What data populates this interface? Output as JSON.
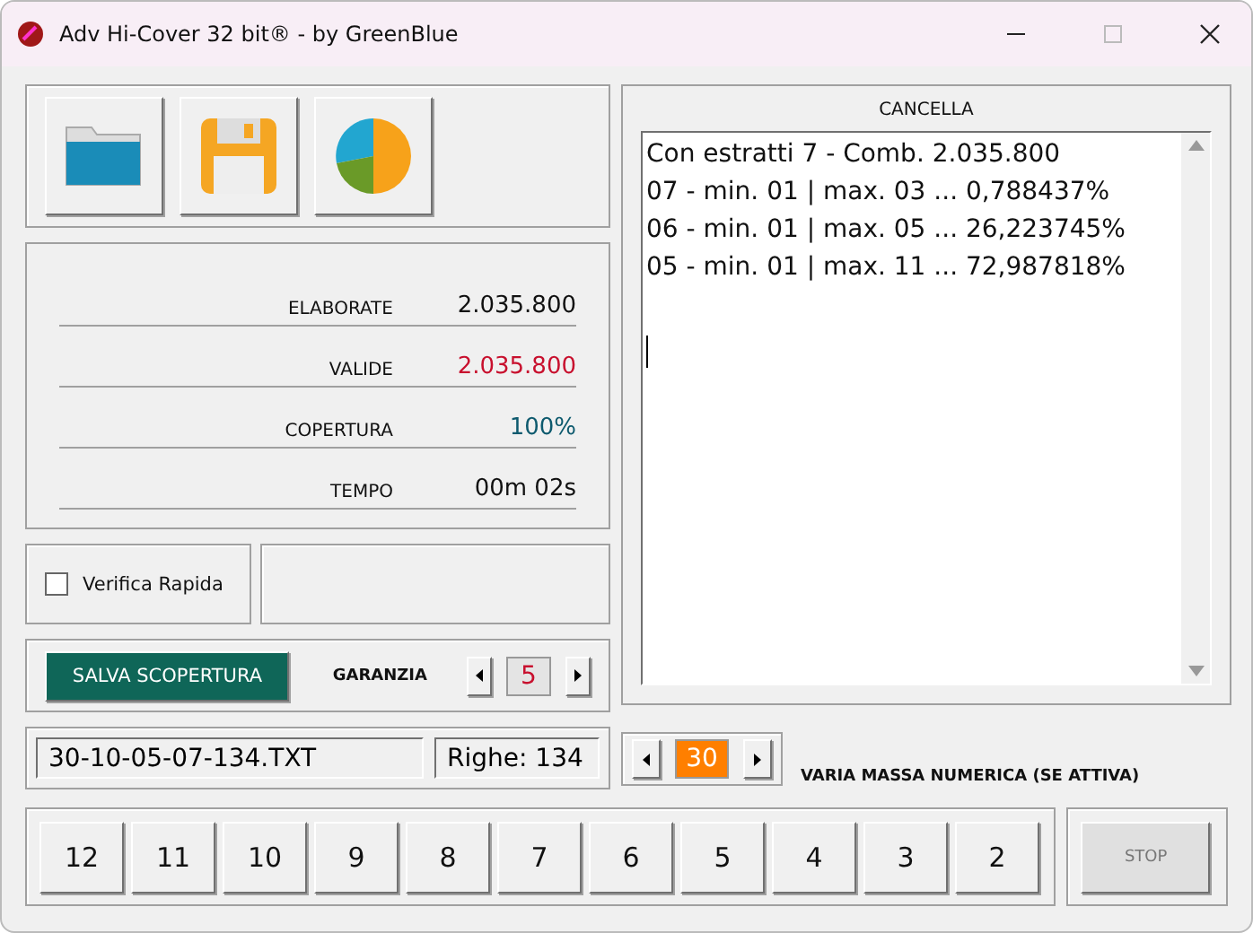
{
  "window": {
    "title": "Adv Hi-Cover 32 bit® - by GreenBlue"
  },
  "stats": [
    {
      "label": "ELABORATE",
      "value": "2.035.800",
      "color": "#111111"
    },
    {
      "label": "VALIDE",
      "value": "2.035.800",
      "color": "#c8102e"
    },
    {
      "label": "COPERTURA",
      "value": "100%",
      "color": "#0e5a6e"
    },
    {
      "label": "TEMPO",
      "value": "00m 02s",
      "color": "#111111"
    }
  ],
  "quick_check": {
    "label": "Verifica Rapida",
    "checked": false
  },
  "save_button": "SALVA SCOPERTURA",
  "guarantee": {
    "label": "GARANZIA",
    "value": "5"
  },
  "file": {
    "name": "30-10-05-07-134.TXT",
    "rows": "Righe: 134"
  },
  "log": {
    "title": "CANCELLA",
    "lines": [
      "Con estratti 7 - Comb. 2.035.800",
      "07 - min. 01 | max. 03 ... 0,788437%",
      "06 - min. 01 | max. 05 ... 26,223745%",
      "05 - min. 01 | max. 11 ... 72,987818%"
    ]
  },
  "mass": {
    "value": "30",
    "label": "VARIA MASSA NUMERICA (SE ATTIVA)"
  },
  "numbers": [
    "12",
    "11",
    "10",
    "9",
    "8",
    "7",
    "6",
    "5",
    "4",
    "3",
    "2"
  ],
  "stop": {
    "label": "STOP",
    "disabled": true
  }
}
